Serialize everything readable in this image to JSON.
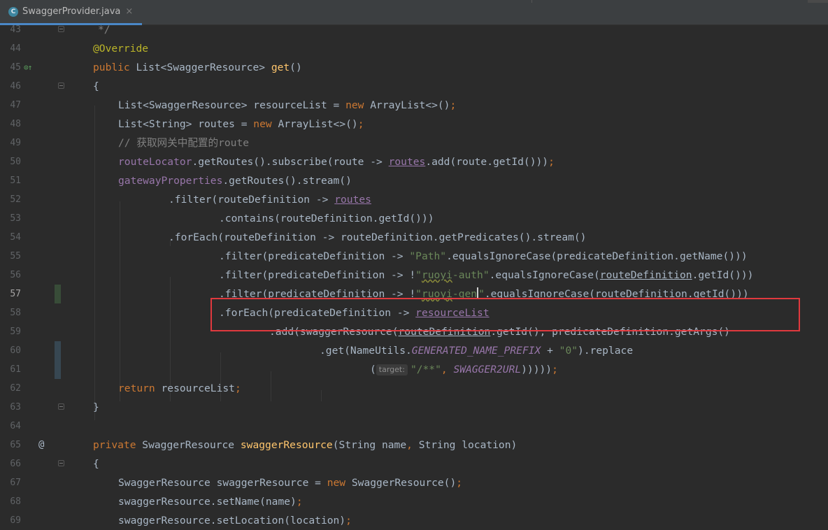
{
  "tab": {
    "icon": "C",
    "name": "SwaggerProvider.java",
    "close": "×"
  },
  "gutter": {
    "override_marker": "⊙↑",
    "implements_marker": "@"
  },
  "lines": {
    "l43": {
      "num": "43",
      "t1": "*/"
    },
    "l44": {
      "num": "44",
      "t1": "@Override"
    },
    "l45": {
      "num": "45",
      "t1": "public ",
      "t2": "List<SwaggerResource> ",
      "t3": "get",
      "t4": "()"
    },
    "l46": {
      "num": "46",
      "t1": "{"
    },
    "l47": {
      "num": "47",
      "t1": "List<SwaggerResource> resourceList = ",
      "t2": "new ",
      "t3": "ArrayList<>()",
      "t4": ";"
    },
    "l48": {
      "num": "48",
      "t1": "List<String> routes = ",
      "t2": "new ",
      "t3": "ArrayList<>()",
      "t4": ";"
    },
    "l49": {
      "num": "49",
      "t1": "// 获取网关中配置的route"
    },
    "l50": {
      "num": "50",
      "t1": "routeLocator",
      "t2": ".getRoutes().subscribe(route -> ",
      "t3": "routes",
      "t4": ".add(route.getId()))",
      "t5": ";"
    },
    "l51": {
      "num": "51",
      "t1": "gatewayProperties",
      "t2": ".getRoutes().stream()"
    },
    "l52": {
      "num": "52",
      "t1": ".filter(routeDefinition -> ",
      "t2": "routes"
    },
    "l53": {
      "num": "53",
      "t1": ".contains(routeDefinition.getId()))"
    },
    "l54": {
      "num": "54",
      "t1": ".forEach(routeDefinition -> routeDefinition.getPredicates().stream()"
    },
    "l55": {
      "num": "55",
      "t1": ".filter(predicateDefinition -> ",
      "t2": "\"Path\"",
      "t3": ".equalsIgnoreCase(predicateDefinition.getName()))"
    },
    "l56": {
      "num": "56",
      "t1": ".filter(predicateDefinition -> !",
      "t2": "\"",
      "t3": "ruoyi",
      "t4": "-auth\"",
      "t5": ".equalsIgnoreCase(",
      "t6": "routeDefinition",
      "t7": ".getId()))"
    },
    "l57": {
      "num": "57",
      "t1": ".filter(predicateDefinition -> !",
      "t2": "\"",
      "t3": "ruoyi",
      "t4": "-gen",
      "t5": "\"",
      "t6": ".equalsIgnoreCase(",
      "t7": "routeDefinition",
      "t8": ".getId()))"
    },
    "l58": {
      "num": "58",
      "t1": ".forEach(predicateDefinition -> ",
      "t2": "resourceList"
    },
    "l59": {
      "num": "59",
      "t1": ".add(swaggerResource(",
      "t2": "routeDefinition",
      "t3": ".getId(), predicateDefinition.getArgs()"
    },
    "l60": {
      "num": "60",
      "t1": ".get(NameUtils.",
      "t2": "GENERATED_NAME_PREFIX",
      "t3": " + ",
      "t4": "\"0\"",
      "t5": ").replace"
    },
    "l61": {
      "num": "61",
      "t1": "(",
      "hint": "target:",
      "t2": "\"/**\"",
      "t3": ", ",
      "t4": "SWAGGER2URL",
      "t5": ")))))",
      "t6": ";"
    },
    "l62": {
      "num": "62",
      "t1": "return ",
      "t2": "resourceList",
      "t3": ";"
    },
    "l63": {
      "num": "63",
      "t1": "}"
    },
    "l64": {
      "num": "64"
    },
    "l65": {
      "num": "65",
      "t1": "private ",
      "t2": "SwaggerResource ",
      "t3": "swaggerResource",
      "t4": "(String name",
      "t5": ", ",
      "t6": "String location)"
    },
    "l66": {
      "num": "66",
      "t1": "{"
    },
    "l67": {
      "num": "67",
      "t1": "SwaggerResource swaggerResource = ",
      "t2": "new ",
      "t3": "SwaggerResource()",
      "t4": ";"
    },
    "l68": {
      "num": "68",
      "t1": "swaggerResource.setName(name)",
      "t2": ";"
    },
    "l69": {
      "num": "69",
      "t1": "swaggerResource.setLocation(location)",
      "t2": ";"
    }
  }
}
